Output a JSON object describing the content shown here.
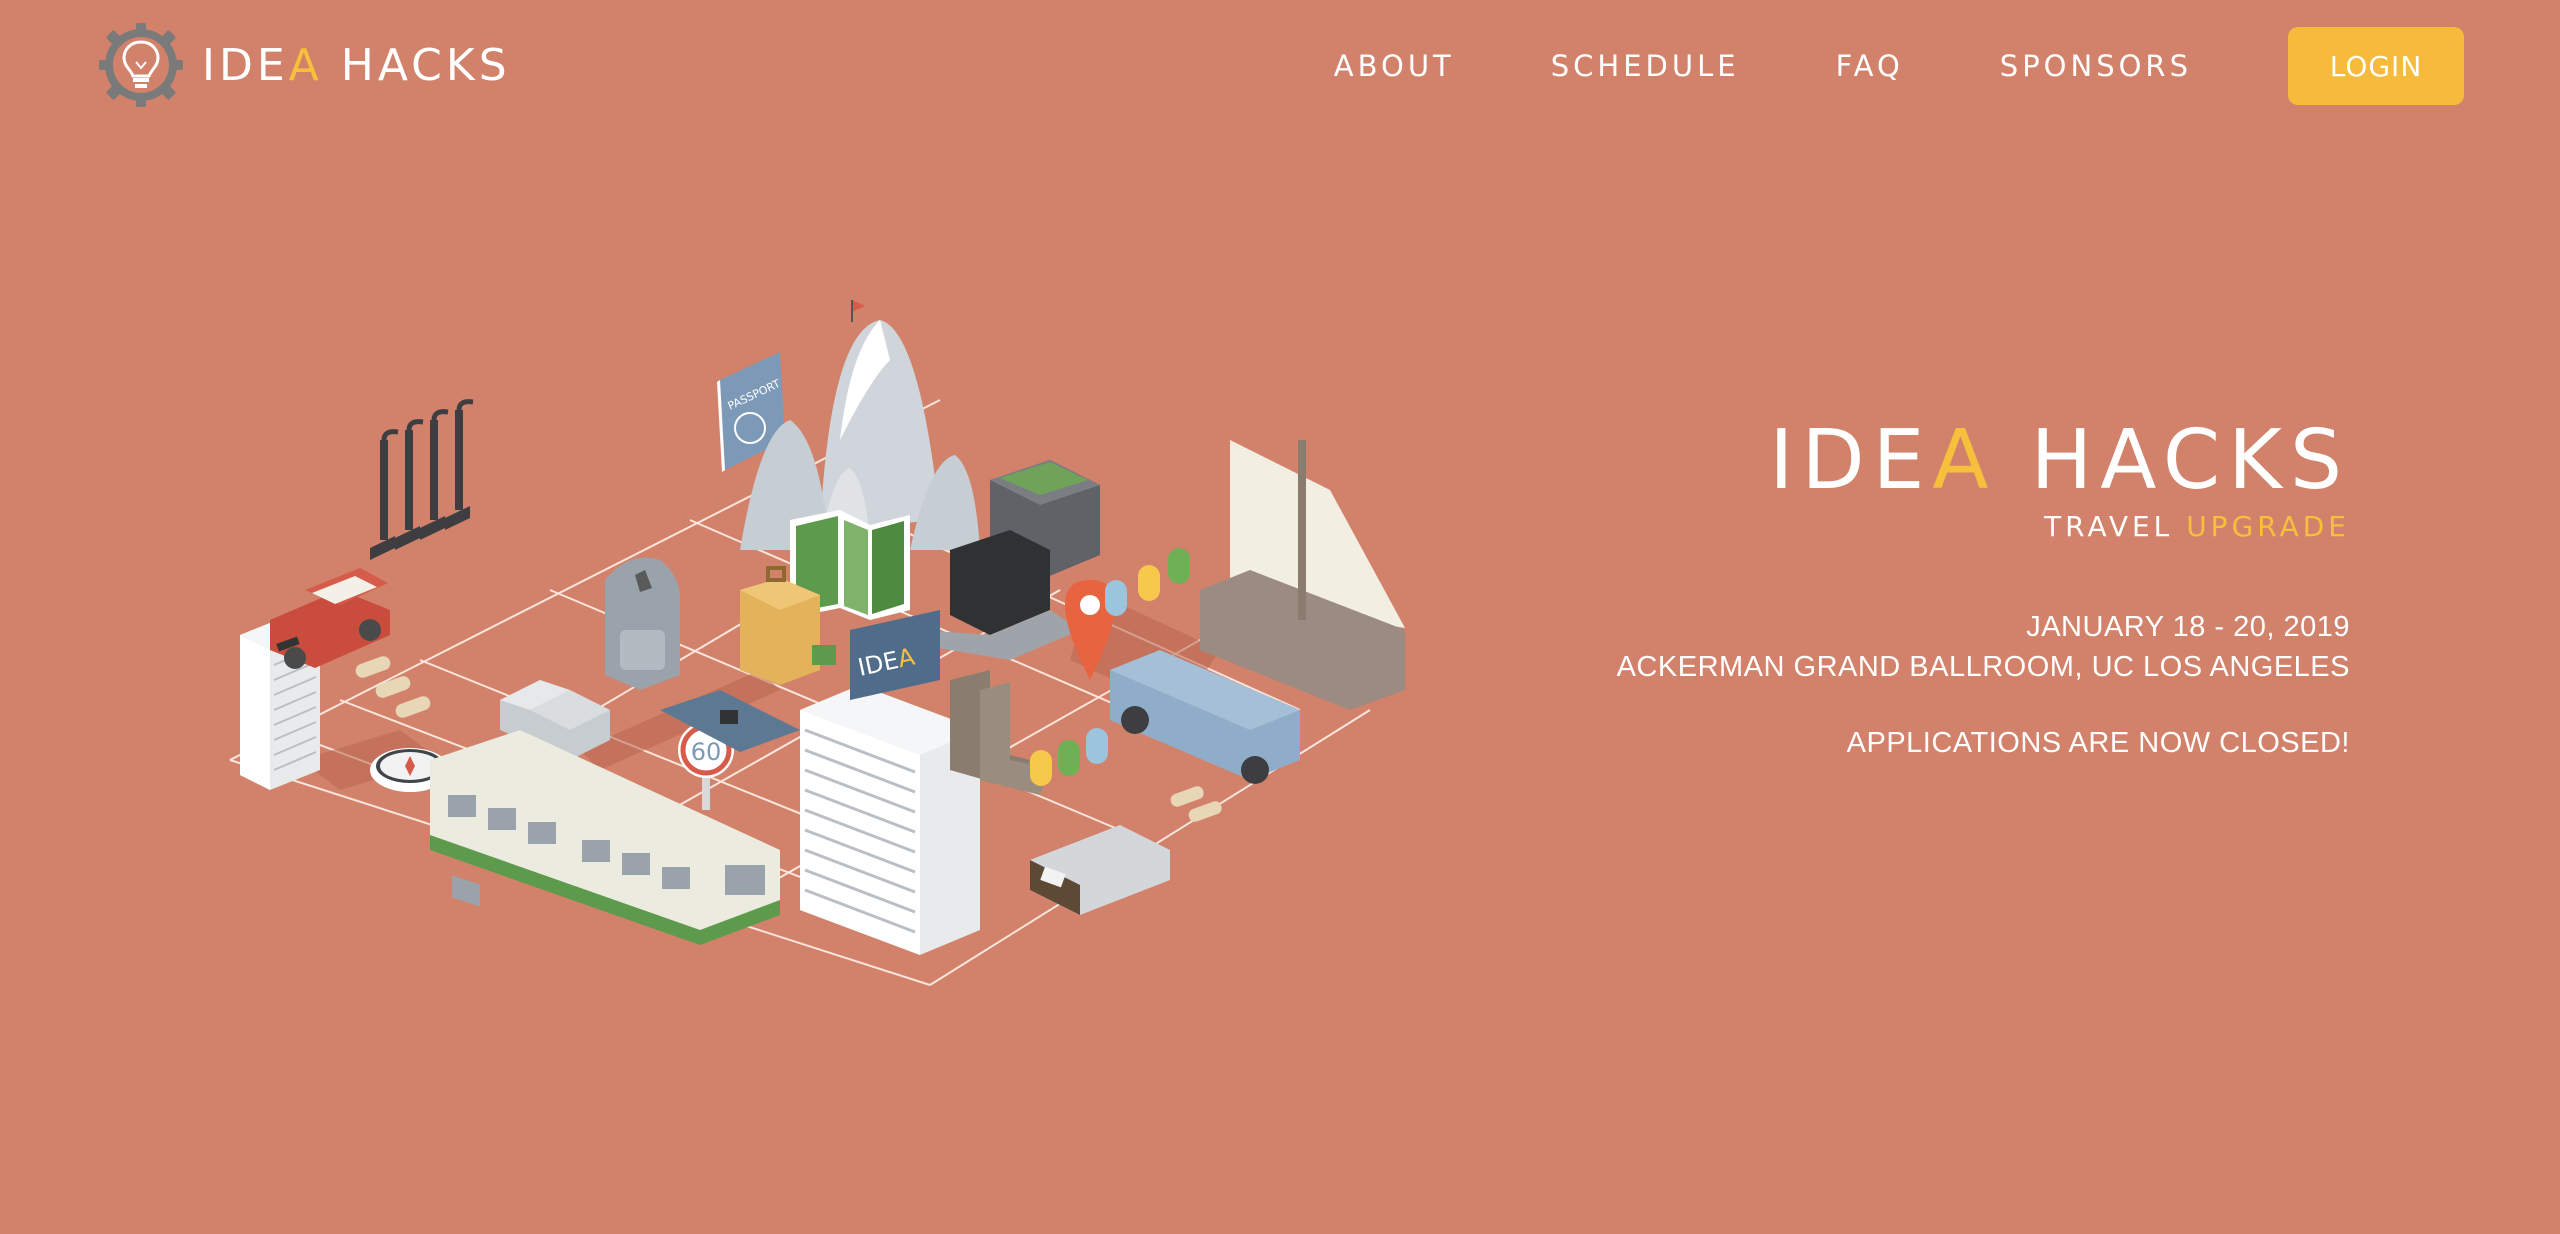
{
  "brand": {
    "name_part1": "IDE",
    "name_accent": "A",
    "name_part2": " HACKS",
    "accent_color": "#f6bf3c"
  },
  "nav": {
    "items": [
      {
        "label": "ABOUT"
      },
      {
        "label": "SCHEDULE"
      },
      {
        "label": "FAQ"
      },
      {
        "label": "SPONSORS"
      }
    ],
    "login_label": "LOGIN",
    "login_color": "#f6bb3a"
  },
  "hero": {
    "title_part1": "IDE",
    "title_accent": "A",
    "title_part2": " HACKS",
    "subtitle_part1": "TRAVEL ",
    "subtitle_accent": "UPGRADE",
    "dates": "JANUARY 18 - 20, 2019",
    "venue": "ACKERMAN GRAND BALLROOM, UC LOS ANGELES",
    "status": "APPLICATIONS ARE NOW CLOSED!"
  },
  "illustration": {
    "passport_label": "PASSPORT",
    "speed_sign": "60",
    "billboard_part1": "IDE",
    "billboard_accent": "A",
    "background_color": "#d2826a"
  }
}
